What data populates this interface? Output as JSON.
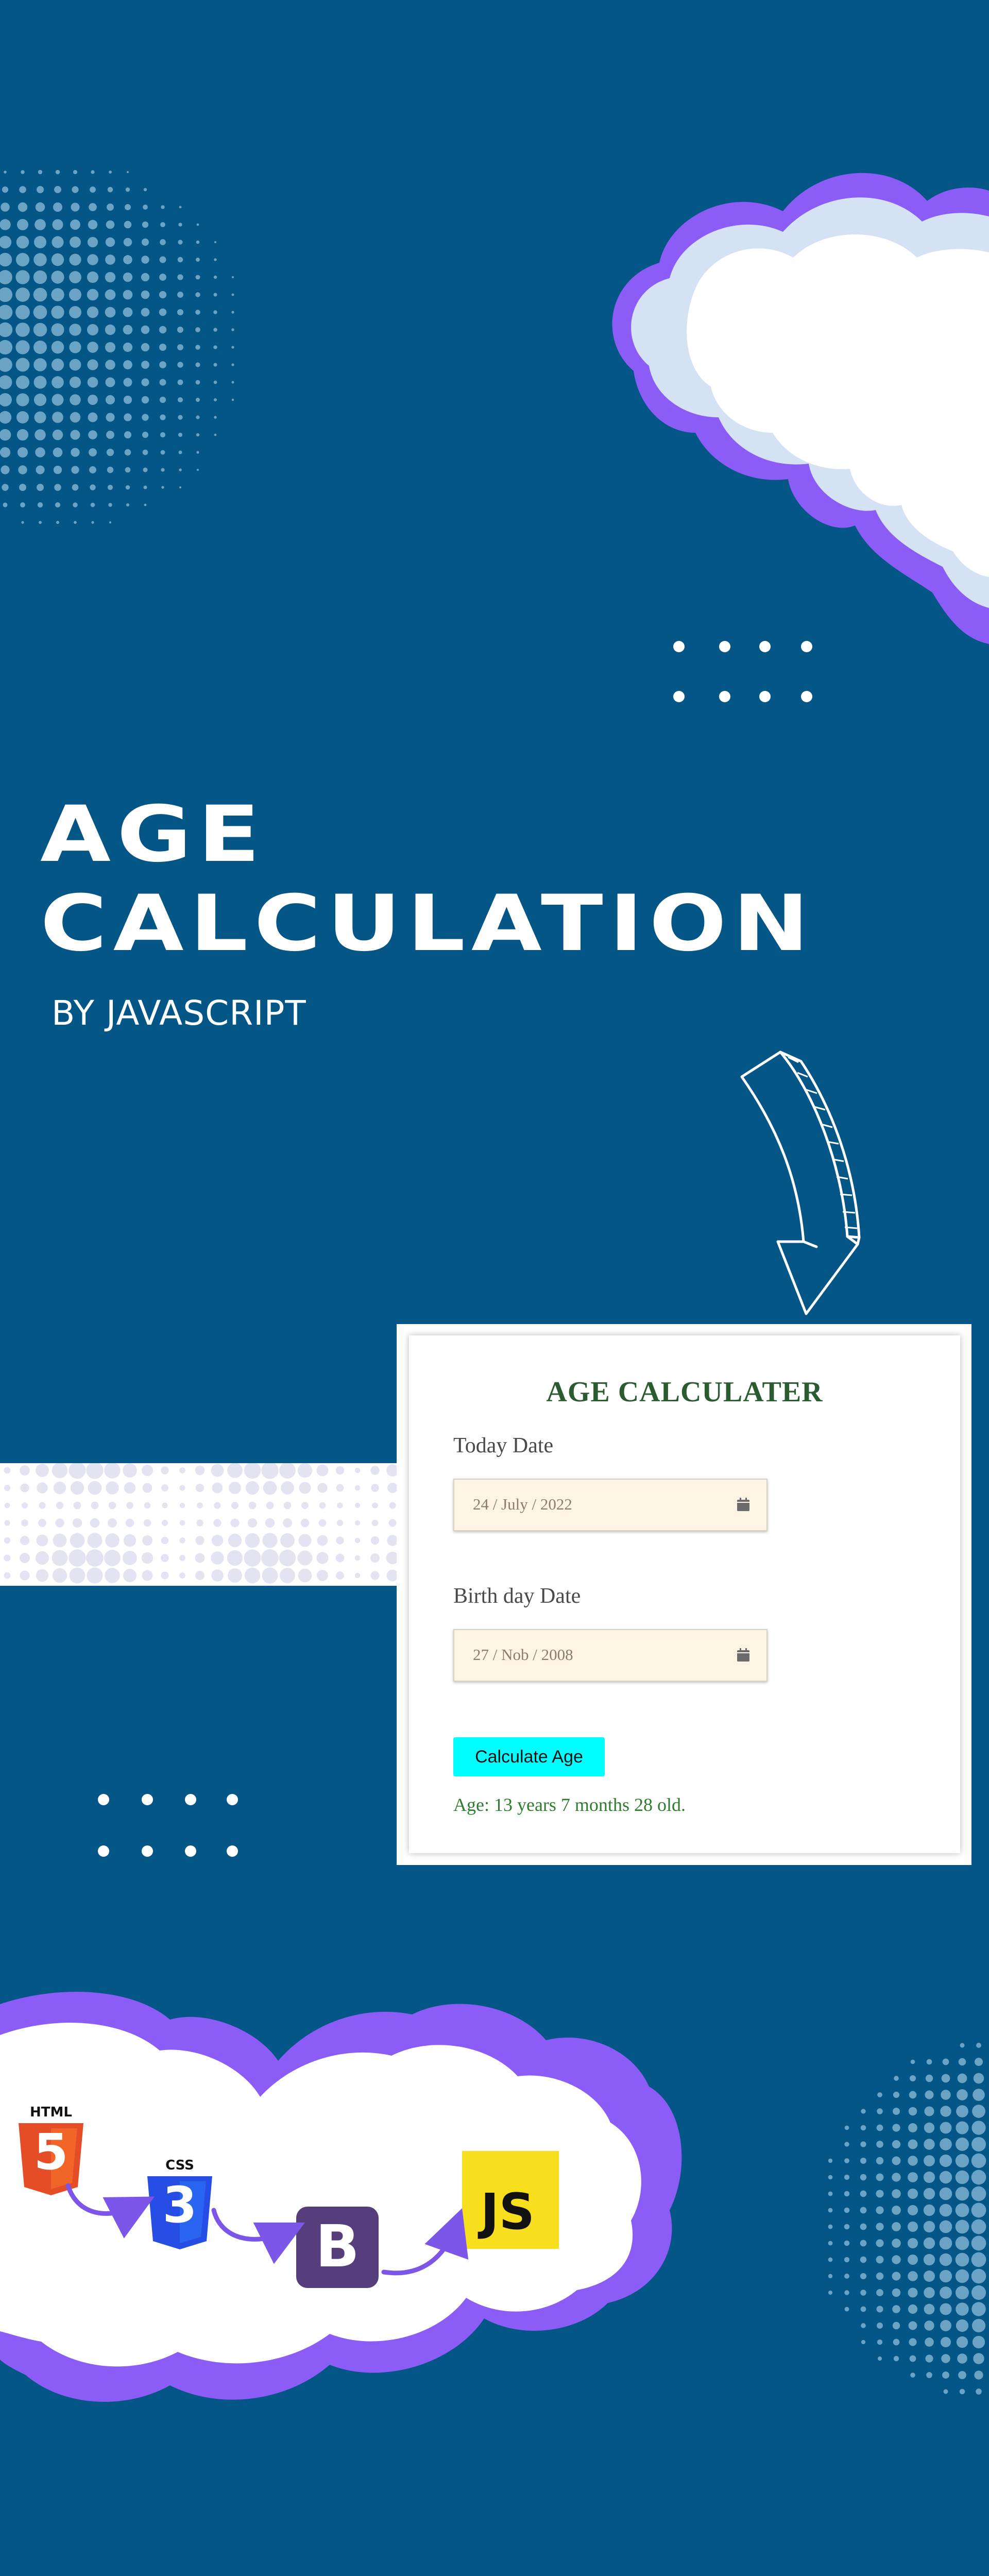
{
  "page": {
    "background_color": "#045686",
    "title_line1": "AGE",
    "title_line2": "CALCULATION",
    "subtitle": "BY JAVASCRIPT"
  },
  "calculator": {
    "heading": "AGE CALCULATER",
    "today_label": "Today Date",
    "today_value": "24 / July / 2022",
    "birth_label": "Birth day Date",
    "birth_value": "27 / Nob / 2008",
    "button_label": "Calculate Age",
    "button_color": "#00ffff",
    "result": "Age: 13 years 7 months 28 old.",
    "heading_color": "#2b5b30",
    "result_color": "#2e7d2e",
    "input_bg": "#fdf4e3"
  },
  "tech_stack": {
    "html_label": "HTML",
    "html_glyph": "5",
    "css_label": "CSS",
    "css_glyph": "3",
    "bootstrap_glyph": "B",
    "js_glyph": "JS",
    "html_color": "#e44d26",
    "css_color": "#264de4",
    "bootstrap_color": "#563d7c",
    "js_color": "#f7df1e"
  },
  "decor": {
    "cloud_outline": "#8b5cf6",
    "cloud_shadow": "#d4e2f4",
    "halftone_color": "#6aa3c4",
    "band_color": "#ffffff",
    "band_dots": "#e4e3f1"
  },
  "icons": [
    "calendar-icon",
    "arrow-down-icon",
    "html5-icon",
    "css3-icon",
    "bootstrap-icon",
    "javascript-icon"
  ]
}
